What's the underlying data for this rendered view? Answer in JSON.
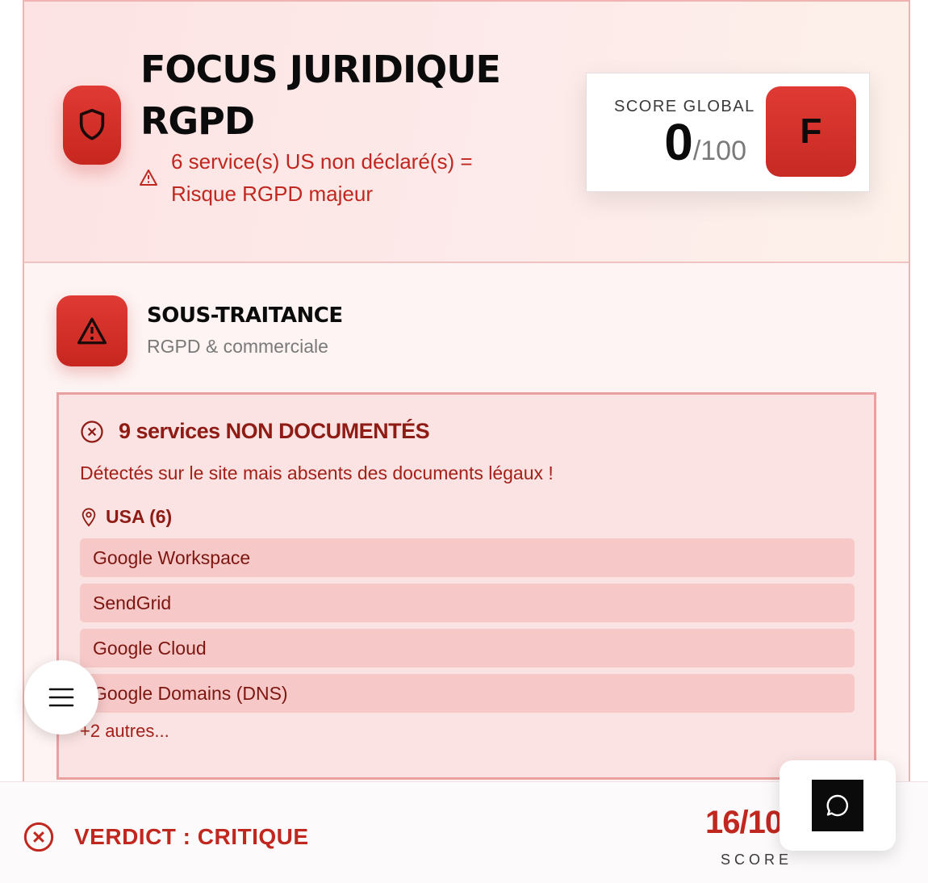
{
  "header": {
    "title_line1": "FOCUS JURIDIQUE",
    "title_line2": "RGPD",
    "warning": "6 service(s) US non déclaré(s) = Risque RGPD majeur",
    "shield_icon": "shield-icon",
    "warning_icon": "alert-triangle-icon"
  },
  "score_card": {
    "label": "SCORE GLOBAL",
    "value": "0",
    "denominator": "/100",
    "grade": "F"
  },
  "section": {
    "title": "SOUS-TRAITANCE",
    "subtitle": "RGPD & commerciale",
    "icon": "alert-triangle-icon"
  },
  "alert": {
    "title": "9 services NON DOCUMENTÉS",
    "description": "Détectés sur le site mais absents des documents légaux !",
    "country": "USA (6)",
    "services": [
      "Google Workspace",
      "SendGrid",
      "Google Cloud",
      "Google Domains (DNS)"
    ],
    "more": "+2 autres..."
  },
  "footer": {
    "verdict": "VERDICT : CRITIQUE",
    "score": "16/10",
    "score_label": "SCORE"
  },
  "colors": {
    "accent_red": "#c7261f",
    "dark_red": "#8f1b15",
    "alert_bg": "#fbe3e3",
    "pill_bg": "#f6c8c7"
  }
}
